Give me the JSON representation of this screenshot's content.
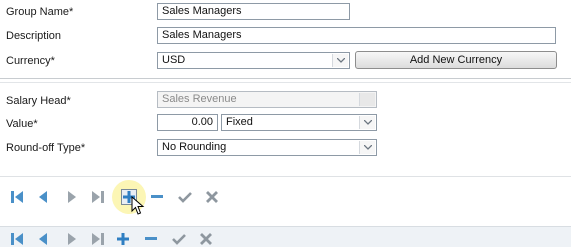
{
  "form": {
    "group_name_label": "Group Name*",
    "group_name_value": "Sales Managers",
    "description_label": "Description",
    "description_value": "Sales Managers",
    "currency_label": "Currency*",
    "currency_value": "USD",
    "add_currency_label": "Add New Currency"
  },
  "salary": {
    "salary_head_label": "Salary Head*",
    "salary_head_value": "Sales Revenue",
    "value_label": "Value*",
    "value_amount": "0.00",
    "value_type": "Fixed",
    "roundoff_label": "Round-off Type*",
    "roundoff_value": "No Rounding"
  },
  "colors": {
    "nav_blue": "#4a90c8",
    "nav_gray": "#9aa3ab",
    "hover_highlight": "#fbf5a8"
  },
  "toolbars": [
    {
      "icons": [
        "first-record-icon",
        "previous-record-icon",
        "next-record-icon",
        "last-record-icon",
        "add-icon",
        "remove-icon",
        "save-check-icon",
        "cancel-x-icon"
      ],
      "active": "add-icon"
    },
    {
      "icons": [
        "first-record-icon",
        "previous-record-icon",
        "next-record-icon",
        "last-record-icon",
        "add-icon",
        "remove-icon",
        "save-check-icon",
        "cancel-x-icon"
      ]
    }
  ]
}
